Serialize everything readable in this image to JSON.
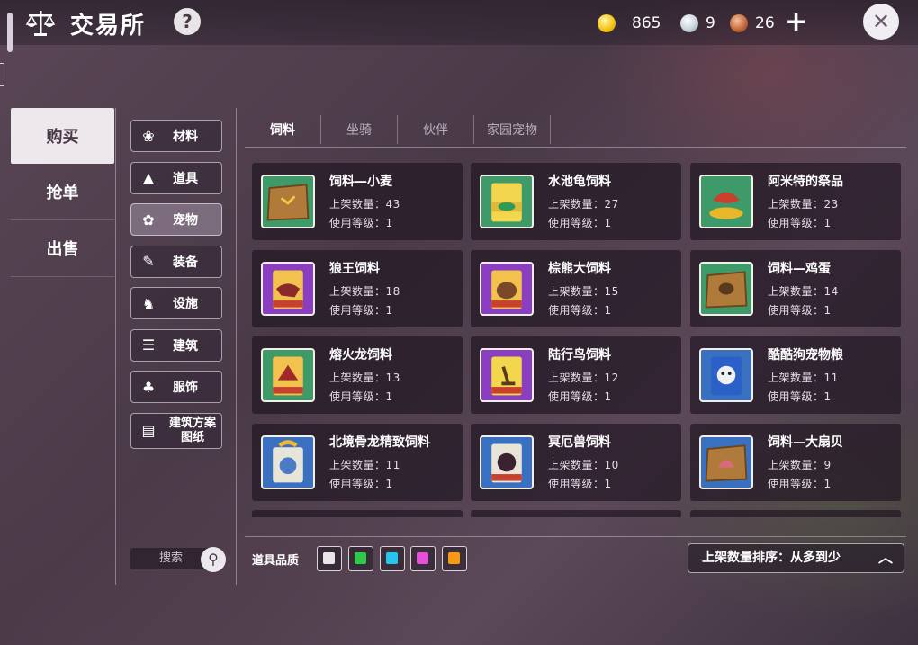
{
  "header": {
    "title": "交易所",
    "help_label": "?",
    "gold": "865",
    "silver": "9",
    "copper": "26",
    "colors": {
      "gold": "#f5c518",
      "silver": "#c9d2dc",
      "copper": "#c46b3c"
    }
  },
  "main_tabs": [
    {
      "label": "购买",
      "active": true
    },
    {
      "label": "抢单",
      "active": false
    },
    {
      "label": "出售",
      "active": false
    }
  ],
  "categories": [
    {
      "label": "材料",
      "icon": "material-icon"
    },
    {
      "label": "道具",
      "icon": "potion-icon"
    },
    {
      "label": "宠物",
      "icon": "paw-icon",
      "active": true
    },
    {
      "label": "装备",
      "icon": "equipment-icon"
    },
    {
      "label": "设施",
      "icon": "facility-icon"
    },
    {
      "label": "建筑",
      "icon": "building-icon"
    },
    {
      "label": "服饰",
      "icon": "clothing-icon"
    },
    {
      "label": "建筑方案图纸",
      "icon": "blueprint-icon"
    }
  ],
  "sub_tabs": [
    {
      "label": "饲料",
      "active": true
    },
    {
      "label": "坐骑",
      "active": false
    },
    {
      "label": "伙伴",
      "active": false
    },
    {
      "label": "家园宠物",
      "active": false
    }
  ],
  "labels": {
    "listed": "上架数量：",
    "level": "使用等级："
  },
  "items": [
    {
      "name": "饲料—小麦",
      "listed": "43",
      "level": "1",
      "icon": "wheat-sack-icon"
    },
    {
      "name": "水池龟饲料",
      "listed": "27",
      "level": "1",
      "icon": "turtle-feed-icon"
    },
    {
      "name": "阿米特的祭品",
      "listed": "23",
      "level": "1",
      "icon": "offering-meat-icon"
    },
    {
      "name": "狼王饲料",
      "listed": "18",
      "level": "1",
      "icon": "wolf-feed-icon"
    },
    {
      "name": "棕熊大饲料",
      "listed": "15",
      "level": "1",
      "icon": "bear-feed-icon"
    },
    {
      "name": "饲料—鸡蛋",
      "listed": "14",
      "level": "1",
      "icon": "egg-sack-icon"
    },
    {
      "name": "熔火龙饲料",
      "listed": "13",
      "level": "1",
      "icon": "dragon-feed-icon"
    },
    {
      "name": "陆行鸟饲料",
      "listed": "12",
      "level": "1",
      "icon": "bird-feed-icon"
    },
    {
      "name": "酷酷狗宠物粮",
      "listed": "11",
      "level": "1",
      "icon": "dog-food-icon"
    },
    {
      "name": "北境骨龙精致饲料",
      "listed": "11",
      "level": "1",
      "icon": "bone-dragon-feed-icon"
    },
    {
      "name": "冥厄兽饲料",
      "listed": "10",
      "level": "1",
      "icon": "beast-feed-icon"
    },
    {
      "name": "饲料—大扇贝",
      "listed": "9",
      "level": "1",
      "icon": "scallop-sack-icon"
    }
  ],
  "footer": {
    "search_label": "搜索",
    "quality_label": "道具品质",
    "quality_colors": [
      "#e8e6e6",
      "#2ec84a",
      "#26c4f0",
      "#e84fd8",
      "#f59a14"
    ],
    "sort_label": "上架数量排序：从多到少"
  }
}
